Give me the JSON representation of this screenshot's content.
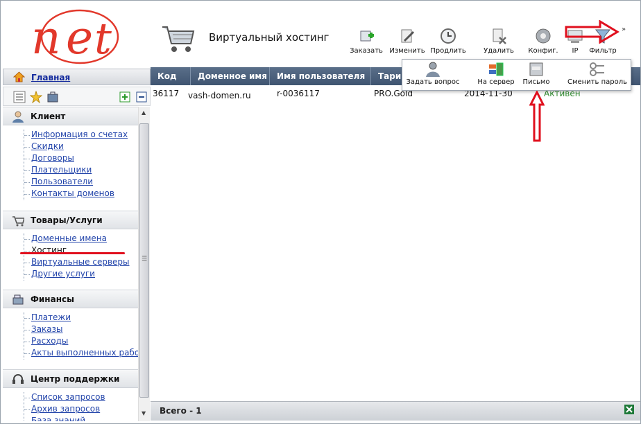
{
  "header": {
    "title": "Виртуальный хостинг",
    "more": "»"
  },
  "toolbar": [
    {
      "label": "Заказать",
      "icon": "cart-add-icon"
    },
    {
      "label": "Изменить",
      "icon": "edit-icon"
    },
    {
      "label": "Продлить",
      "icon": "clock-icon"
    },
    {
      "label": "Удалить",
      "icon": "delete-icon"
    },
    {
      "label": "Конфиг.",
      "icon": "config-icon"
    },
    {
      "label": "IP",
      "icon": "ip-icon"
    },
    {
      "label": "Фильтр",
      "icon": "filter-icon"
    }
  ],
  "nav": {
    "main": "Главная"
  },
  "sidebar": {
    "client": {
      "title": "Клиент",
      "items": [
        "Информация о счетах",
        "Скидки",
        "Договоры",
        "Плательщики",
        "Пользователи",
        "Контакты доменов"
      ]
    },
    "goods": {
      "title": "Товары/Услуги",
      "items": [
        "Доменные имена",
        "Хостинг",
        "Виртуальные серверы",
        "Другие услуги"
      ]
    },
    "finance": {
      "title": "Финансы",
      "items": [
        "Платежи",
        "Заказы",
        "Расходы",
        "Акты выполненных работ"
      ]
    },
    "support": {
      "title": "Центр поддержки",
      "items": [
        "Список запросов",
        "Архив запросов",
        "База знаний"
      ]
    }
  },
  "grid": {
    "columns": [
      "Код",
      "Доменное имя",
      "Имя пользователя",
      "Тари"
    ],
    "rows": [
      {
        "code": "36117",
        "domain": "vash-domen.ru",
        "user": "r-0036117",
        "tariff": "PRO.Gold",
        "date": "2014-11-30",
        "status": "Активен"
      }
    ],
    "footer": "Всего - 1"
  },
  "popup": {
    "items": [
      "Задать вопрос",
      "На сервер",
      "Письмо",
      "Сменить пароль"
    ]
  },
  "colors": {
    "header_bg": "#4b5f7a",
    "accent_red": "#e0101e",
    "status_green": "#2d8a2d",
    "link": "#2244aa"
  }
}
